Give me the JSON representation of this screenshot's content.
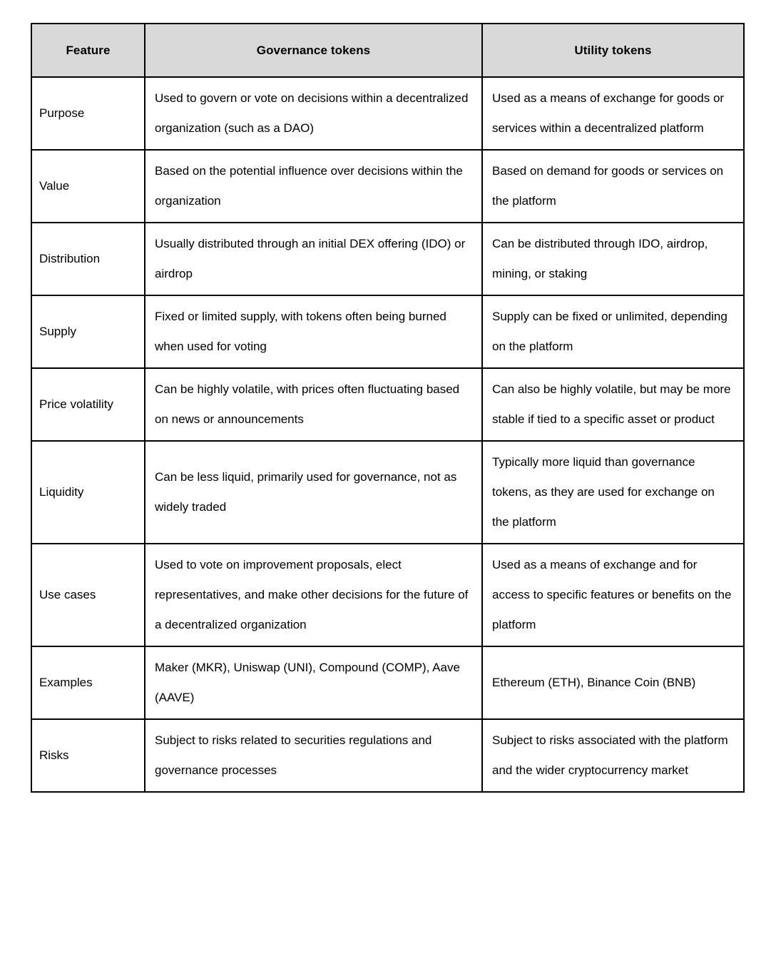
{
  "table": {
    "headers": [
      {
        "label": "Feature"
      },
      {
        "label": "Governance tokens"
      },
      {
        "label": "Utility tokens"
      }
    ],
    "header_background": "#d9d9d9",
    "border_color": "#000000",
    "rows": [
      {
        "feature": "Purpose",
        "governance": "Used to govern or vote on decisions within a decentralized organization (such as a DAO)",
        "utility": "Used as a means of exchange for goods or services within a decentralized platform"
      },
      {
        "feature": "Value",
        "governance": "Based on the potential influence over decisions within the organization",
        "utility": "Based on demand for goods or services on the platform"
      },
      {
        "feature": "Distribution",
        "governance": "Usually distributed through an initial DEX offering (IDO) or airdrop",
        "utility": "Can be distributed through IDO, airdrop, mining, or staking"
      },
      {
        "feature": "Supply",
        "governance": "Fixed or limited supply, with tokens often being burned when used for voting",
        "utility": "Supply can be fixed or unlimited, depending on the platform"
      },
      {
        "feature": "Price volatility",
        "governance": "Can be highly volatile, with prices often fluctuating based on news or announcements",
        "utility": "Can also be highly volatile, but may be more stable if tied to a specific asset or product"
      },
      {
        "feature": "Liquidity",
        "governance": "Can be less liquid, primarily used for governance, not as widely traded",
        "utility": "Typically more liquid than governance tokens, as they are used for exchange on the platform"
      },
      {
        "feature": "Use cases",
        "governance": "Used to vote on improvement proposals, elect representatives, and make other decisions for the future of a decentralized organization",
        "utility": "Used as a means of exchange and for access to specific features or benefits on the platform"
      },
      {
        "feature": "Examples",
        "governance": "Maker (MKR), Uniswap (UNI), Compound (COMP), Aave (AAVE)",
        "utility": "Ethereum (ETH), Binance Coin (BNB)"
      },
      {
        "feature": "Risks",
        "governance": "Subject to risks related to securities regulations and governance processes",
        "utility": "Subject to risks associated with the platform and the wider cryptocurrency market"
      }
    ]
  }
}
